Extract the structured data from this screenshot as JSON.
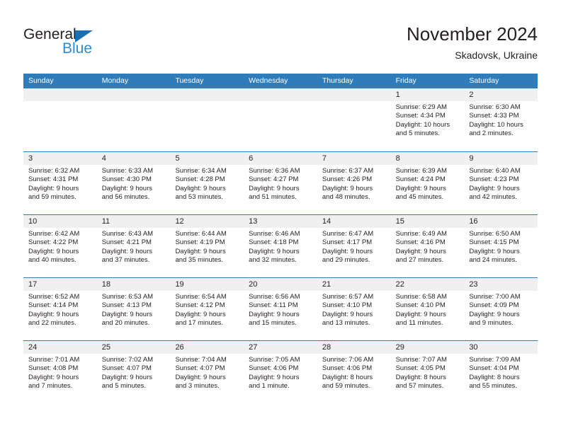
{
  "logo": {
    "name_part1": "General",
    "name_part2": "Blue",
    "triangle_color": "#1b6fb5",
    "text_color": "#231f20",
    "blue_color": "#2e8bd0"
  },
  "header": {
    "title": "November 2024",
    "subtitle": "Skadovsk, Ukraine"
  },
  "theme": {
    "header_bg": "#2e7cba",
    "header_text": "#ffffff",
    "daynum_bg": "#f0f0f0",
    "body_text": "#231f20"
  },
  "weekdays": [
    "Sunday",
    "Monday",
    "Tuesday",
    "Wednesday",
    "Thursday",
    "Friday",
    "Saturday"
  ],
  "weeks": [
    [
      {
        "day": "",
        "empty": true
      },
      {
        "day": "",
        "empty": true
      },
      {
        "day": "",
        "empty": true
      },
      {
        "day": "",
        "empty": true
      },
      {
        "day": "",
        "empty": true
      },
      {
        "day": "1",
        "sunrise": "Sunrise: 6:29 AM",
        "sunset": "Sunset: 4:34 PM",
        "daylight1": "Daylight: 10 hours",
        "daylight2": "and 5 minutes."
      },
      {
        "day": "2",
        "sunrise": "Sunrise: 6:30 AM",
        "sunset": "Sunset: 4:33 PM",
        "daylight1": "Daylight: 10 hours",
        "daylight2": "and 2 minutes."
      }
    ],
    [
      {
        "day": "3",
        "sunrise": "Sunrise: 6:32 AM",
        "sunset": "Sunset: 4:31 PM",
        "daylight1": "Daylight: 9 hours",
        "daylight2": "and 59 minutes."
      },
      {
        "day": "4",
        "sunrise": "Sunrise: 6:33 AM",
        "sunset": "Sunset: 4:30 PM",
        "daylight1": "Daylight: 9 hours",
        "daylight2": "and 56 minutes."
      },
      {
        "day": "5",
        "sunrise": "Sunrise: 6:34 AM",
        "sunset": "Sunset: 4:28 PM",
        "daylight1": "Daylight: 9 hours",
        "daylight2": "and 53 minutes."
      },
      {
        "day": "6",
        "sunrise": "Sunrise: 6:36 AM",
        "sunset": "Sunset: 4:27 PM",
        "daylight1": "Daylight: 9 hours",
        "daylight2": "and 51 minutes."
      },
      {
        "day": "7",
        "sunrise": "Sunrise: 6:37 AM",
        "sunset": "Sunset: 4:26 PM",
        "daylight1": "Daylight: 9 hours",
        "daylight2": "and 48 minutes."
      },
      {
        "day": "8",
        "sunrise": "Sunrise: 6:39 AM",
        "sunset": "Sunset: 4:24 PM",
        "daylight1": "Daylight: 9 hours",
        "daylight2": "and 45 minutes."
      },
      {
        "day": "9",
        "sunrise": "Sunrise: 6:40 AM",
        "sunset": "Sunset: 4:23 PM",
        "daylight1": "Daylight: 9 hours",
        "daylight2": "and 42 minutes."
      }
    ],
    [
      {
        "day": "10",
        "sunrise": "Sunrise: 6:42 AM",
        "sunset": "Sunset: 4:22 PM",
        "daylight1": "Daylight: 9 hours",
        "daylight2": "and 40 minutes."
      },
      {
        "day": "11",
        "sunrise": "Sunrise: 6:43 AM",
        "sunset": "Sunset: 4:21 PM",
        "daylight1": "Daylight: 9 hours",
        "daylight2": "and 37 minutes."
      },
      {
        "day": "12",
        "sunrise": "Sunrise: 6:44 AM",
        "sunset": "Sunset: 4:19 PM",
        "daylight1": "Daylight: 9 hours",
        "daylight2": "and 35 minutes."
      },
      {
        "day": "13",
        "sunrise": "Sunrise: 6:46 AM",
        "sunset": "Sunset: 4:18 PM",
        "daylight1": "Daylight: 9 hours",
        "daylight2": "and 32 minutes."
      },
      {
        "day": "14",
        "sunrise": "Sunrise: 6:47 AM",
        "sunset": "Sunset: 4:17 PM",
        "daylight1": "Daylight: 9 hours",
        "daylight2": "and 29 minutes."
      },
      {
        "day": "15",
        "sunrise": "Sunrise: 6:49 AM",
        "sunset": "Sunset: 4:16 PM",
        "daylight1": "Daylight: 9 hours",
        "daylight2": "and 27 minutes."
      },
      {
        "day": "16",
        "sunrise": "Sunrise: 6:50 AM",
        "sunset": "Sunset: 4:15 PM",
        "daylight1": "Daylight: 9 hours",
        "daylight2": "and 24 minutes."
      }
    ],
    [
      {
        "day": "17",
        "sunrise": "Sunrise: 6:52 AM",
        "sunset": "Sunset: 4:14 PM",
        "daylight1": "Daylight: 9 hours",
        "daylight2": "and 22 minutes."
      },
      {
        "day": "18",
        "sunrise": "Sunrise: 6:53 AM",
        "sunset": "Sunset: 4:13 PM",
        "daylight1": "Daylight: 9 hours",
        "daylight2": "and 20 minutes."
      },
      {
        "day": "19",
        "sunrise": "Sunrise: 6:54 AM",
        "sunset": "Sunset: 4:12 PM",
        "daylight1": "Daylight: 9 hours",
        "daylight2": "and 17 minutes."
      },
      {
        "day": "20",
        "sunrise": "Sunrise: 6:56 AM",
        "sunset": "Sunset: 4:11 PM",
        "daylight1": "Daylight: 9 hours",
        "daylight2": "and 15 minutes."
      },
      {
        "day": "21",
        "sunrise": "Sunrise: 6:57 AM",
        "sunset": "Sunset: 4:10 PM",
        "daylight1": "Daylight: 9 hours",
        "daylight2": "and 13 minutes."
      },
      {
        "day": "22",
        "sunrise": "Sunrise: 6:58 AM",
        "sunset": "Sunset: 4:10 PM",
        "daylight1": "Daylight: 9 hours",
        "daylight2": "and 11 minutes."
      },
      {
        "day": "23",
        "sunrise": "Sunrise: 7:00 AM",
        "sunset": "Sunset: 4:09 PM",
        "daylight1": "Daylight: 9 hours",
        "daylight2": "and 9 minutes."
      }
    ],
    [
      {
        "day": "24",
        "sunrise": "Sunrise: 7:01 AM",
        "sunset": "Sunset: 4:08 PM",
        "daylight1": "Daylight: 9 hours",
        "daylight2": "and 7 minutes."
      },
      {
        "day": "25",
        "sunrise": "Sunrise: 7:02 AM",
        "sunset": "Sunset: 4:07 PM",
        "daylight1": "Daylight: 9 hours",
        "daylight2": "and 5 minutes."
      },
      {
        "day": "26",
        "sunrise": "Sunrise: 7:04 AM",
        "sunset": "Sunset: 4:07 PM",
        "daylight1": "Daylight: 9 hours",
        "daylight2": "and 3 minutes."
      },
      {
        "day": "27",
        "sunrise": "Sunrise: 7:05 AM",
        "sunset": "Sunset: 4:06 PM",
        "daylight1": "Daylight: 9 hours",
        "daylight2": "and 1 minute."
      },
      {
        "day": "28",
        "sunrise": "Sunrise: 7:06 AM",
        "sunset": "Sunset: 4:06 PM",
        "daylight1": "Daylight: 8 hours",
        "daylight2": "and 59 minutes."
      },
      {
        "day": "29",
        "sunrise": "Sunrise: 7:07 AM",
        "sunset": "Sunset: 4:05 PM",
        "daylight1": "Daylight: 8 hours",
        "daylight2": "and 57 minutes."
      },
      {
        "day": "30",
        "sunrise": "Sunrise: 7:09 AM",
        "sunset": "Sunset: 4:04 PM",
        "daylight1": "Daylight: 8 hours",
        "daylight2": "and 55 minutes."
      }
    ]
  ]
}
